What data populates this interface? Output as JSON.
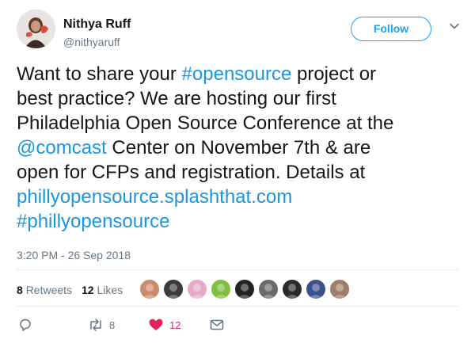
{
  "tweet": {
    "author_name": "Nithya Ruff",
    "author_handle": "@nithyaruff",
    "follow_label": "Follow",
    "text_lines": [
      [
        {
          "t": "Want to share your ",
          "link": false
        },
        {
          "t": "#opensource",
          "link": true
        },
        {
          "t": " project or",
          "link": false
        }
      ],
      [
        {
          "t": "best practice?  We are hosting our first",
          "link": false
        }
      ],
      [
        {
          "t": "Philadelphia Open Source Conference at the",
          "link": false
        }
      ],
      [
        {
          "t": "@comcast",
          "link": true
        },
        {
          "t": " Center on November 7th & are",
          "link": false
        }
      ],
      [
        {
          "t": "open for CFPs and registration. Details at",
          "link": false
        }
      ],
      [
        {
          "t": "phillyopensource.splashthat.com",
          "link": true
        }
      ],
      [
        {
          "t": "#phillyopensource",
          "link": true
        }
      ]
    ],
    "timestamp": "3:20 PM - 26 Sep 2018"
  },
  "stats": {
    "retweets_count": "8",
    "retweets_label": "Retweets",
    "likes_count": "12",
    "likes_label": "Likes"
  },
  "likers": [
    {
      "name": "liker-1",
      "color": "#c98b6b"
    },
    {
      "name": "liker-2",
      "color": "#3b3b3b"
    },
    {
      "name": "liker-3",
      "color": "#e8a9c4"
    },
    {
      "name": "liker-4",
      "color": "#7fbe3f"
    },
    {
      "name": "liker-5",
      "color": "#232323"
    },
    {
      "name": "liker-6",
      "color": "#6b6b6b"
    },
    {
      "name": "liker-7",
      "color": "#2a2a2a"
    },
    {
      "name": "liker-8",
      "color": "#3a4f8c"
    },
    {
      "name": "liker-9",
      "color": "#a07d68"
    }
  ],
  "actions": {
    "reply_icon": "reply-icon",
    "retweet_icon": "retweet-icon",
    "retweet_count": "8",
    "like_icon": "heart-icon",
    "like_count": "12",
    "dm_icon": "envelope-icon"
  },
  "colors": {
    "link": "#1b95e0",
    "follow": "#1da1f2",
    "like": "#e0245e",
    "muted": "#657786"
  }
}
